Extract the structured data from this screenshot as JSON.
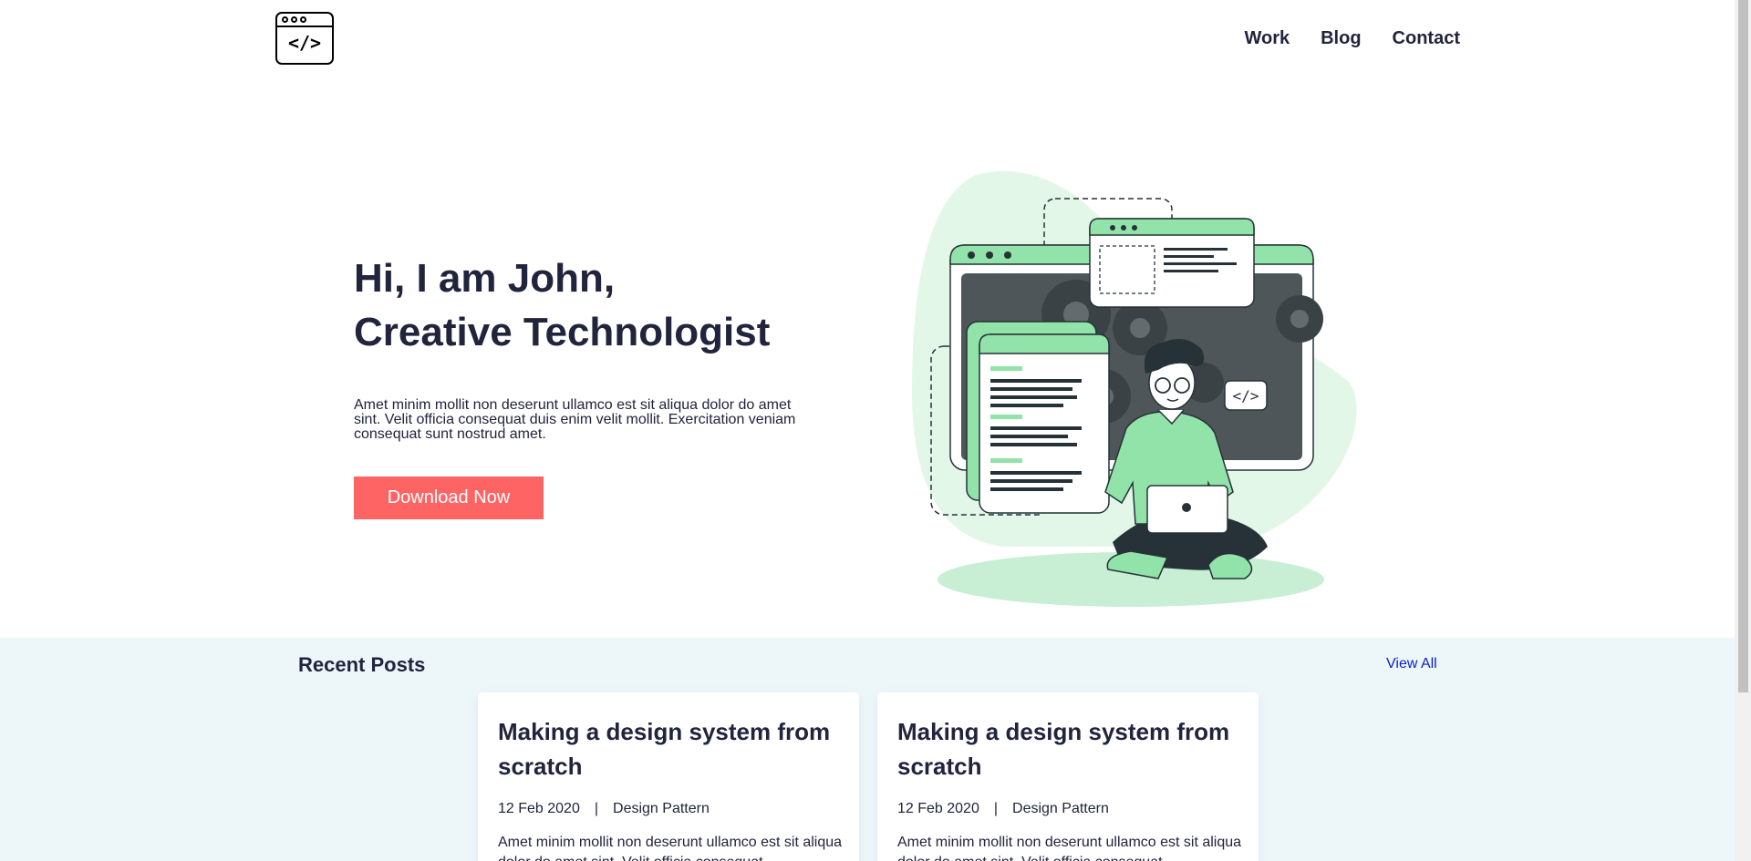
{
  "header": {
    "logo_icon": "code-window-icon",
    "logo_code": "</>",
    "nav": [
      {
        "label": "Work"
      },
      {
        "label": "Blog"
      },
      {
        "label": "Contact"
      }
    ]
  },
  "hero": {
    "title_line1": "Hi, I am John,",
    "title_line2": "Creative Technologist",
    "description": "Amet minim mollit non deserunt ullamco est sit aliqua dolor do amet sint. Velit officia consequat duis enim velit mollit. Exercitation veniam consequat sunt nostrud amet.",
    "button_label": "Download Now",
    "illustration": "developer-with-laptop-illustration",
    "illustration_code": "</>"
  },
  "recent_posts": {
    "title": "Recent Posts",
    "view_all": "View All",
    "posts": [
      {
        "title": "Making a design system from scratch",
        "date": "12 Feb 2020",
        "separator": "|",
        "category": "Design Pattern",
        "excerpt": "Amet minim mollit non deserunt ullamco est sit aliqua dolor do amet sint. Velit officia consequat"
      },
      {
        "title": "Making a design system from scratch",
        "date": "12 Feb 2020",
        "separator": "|",
        "category": "Design Pattern",
        "excerpt": "Amet minim mollit non deserunt ullamco est sit aliqua dolor do amet sint. Velit officia consequat"
      }
    ]
  },
  "colors": {
    "primary_text": "#21243d",
    "accent_button": "#ff6464",
    "section_bg": "#edf7fa",
    "illustration_green": "#92e3a9",
    "link_blue": "#0a1fd0"
  }
}
